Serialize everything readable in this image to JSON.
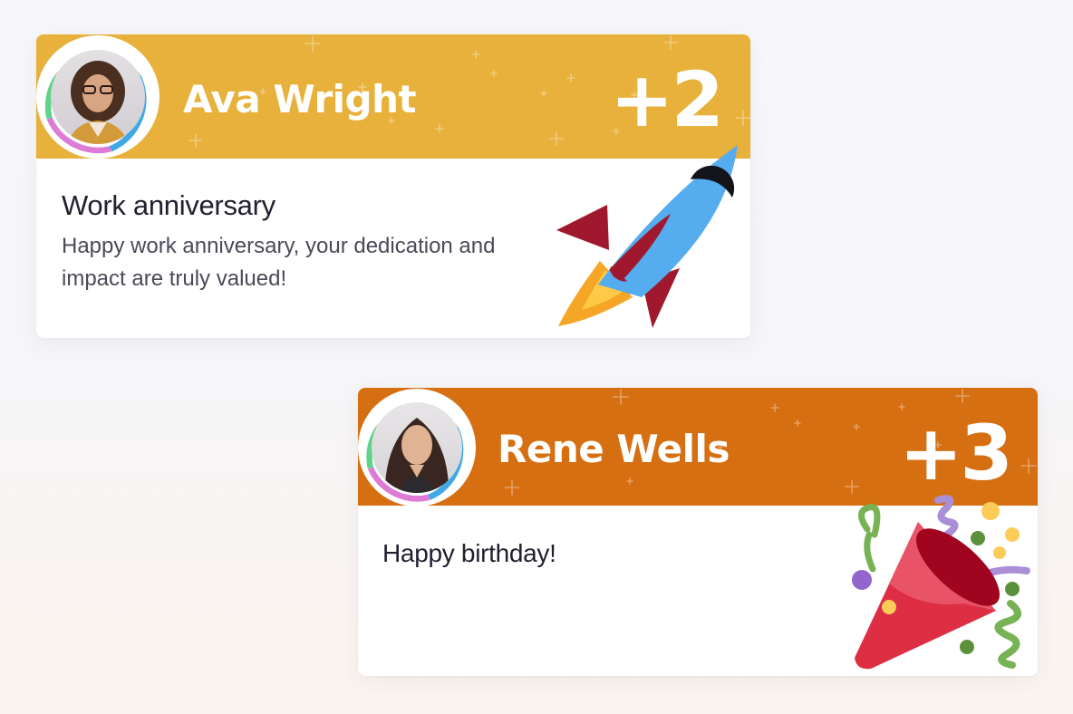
{
  "cards": [
    {
      "name": "Ava Wright",
      "count": "+2",
      "title": "Work anniversary",
      "message": "Happy work anniversary, your dedication and impact are truly valued!",
      "banner_color": "#e8b13c",
      "illustration": "rocket-icon"
    },
    {
      "name": "Rene Wells",
      "count": "+3",
      "title": "Happy birthday!",
      "banner_color": "#d66f12",
      "illustration": "party-popper-icon"
    }
  ],
  "ring_colors": [
    "#f4b44a",
    "#3fa9e8",
    "#dd7bd6",
    "#5fd38a"
  ]
}
